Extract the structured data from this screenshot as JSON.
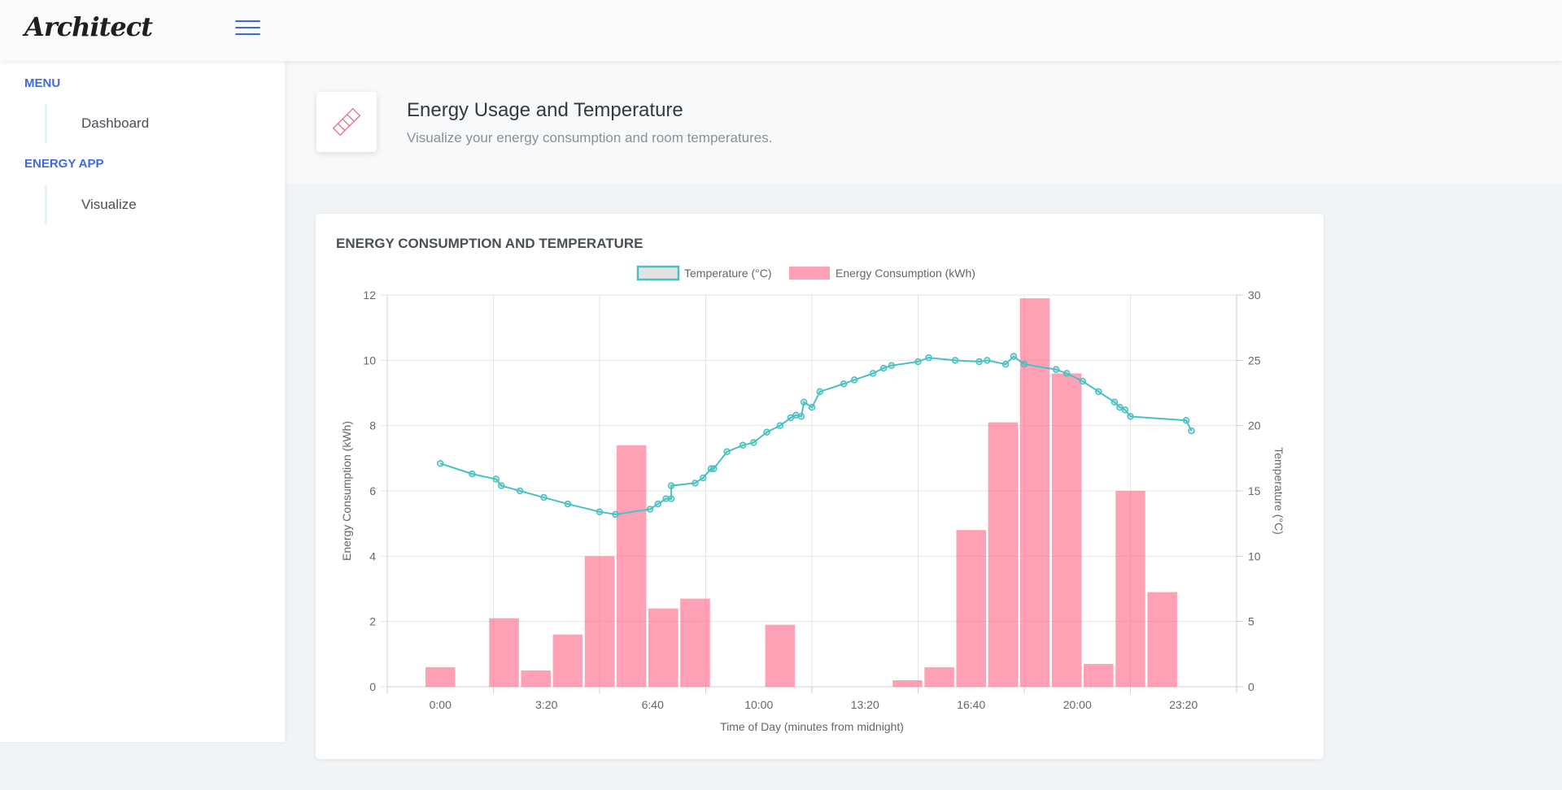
{
  "header": {
    "logo_text": "Architect",
    "menu_icon": "hamburger-icon"
  },
  "sidebar": {
    "sections": [
      {
        "heading": "MENU",
        "items": [
          {
            "label": "Dashboard"
          }
        ]
      },
      {
        "heading": "ENERGY APP",
        "items": [
          {
            "label": "Visualize"
          }
        ]
      }
    ]
  },
  "page": {
    "icon": "ruler-icon",
    "title": "Energy Usage and Temperature",
    "subtitle": "Visualize your energy consumption and room temperatures."
  },
  "card": {
    "title": "ENERGY CONSUMPTION AND TEMPERATURE"
  },
  "colors": {
    "temperature": "#4bc0c0",
    "energy": "#ff6384",
    "accent": "#3f6ad8"
  },
  "chart_data": {
    "type": "bar",
    "xlabel": "Time of Day (minutes from midnight)",
    "ylabel_left": "Energy Consumption (kWh)",
    "ylabel_right": "Temperature (°C)",
    "xlim": [
      -100,
      1500
    ],
    "xticks": [
      0,
      200,
      400,
      600,
      800,
      1000,
      1200,
      1400
    ],
    "xtick_labels": [
      "0:00",
      "3:20",
      "6:40",
      "10:00",
      "13:20",
      "16:40",
      "20:00",
      "23:20"
    ],
    "ylim_left": [
      0,
      12
    ],
    "yticks_left": [
      0,
      2,
      4,
      6,
      8,
      10,
      12
    ],
    "ylim_right": [
      0,
      30
    ],
    "yticks_right": [
      0,
      5,
      10,
      15,
      20,
      25,
      30
    ],
    "legend_position": "top",
    "grid": true,
    "series": [
      {
        "name": "Temperature (°C)",
        "type": "line",
        "axis": "right",
        "x": [
          0,
          60,
          105,
          115,
          150,
          195,
          240,
          300,
          330,
          395,
          410,
          425,
          435,
          435,
          480,
          495,
          510,
          515,
          540,
          570,
          590,
          615,
          640,
          660,
          670,
          680,
          685,
          700,
          715,
          760,
          780,
          815,
          835,
          850,
          900,
          920,
          970,
          1015,
          1030,
          1065,
          1080,
          1100,
          1160,
          1180,
          1210,
          1240,
          1270,
          1280,
          1290,
          1300,
          1405,
          1415
        ],
        "values": [
          17.1,
          16.3,
          15.9,
          15.4,
          15.0,
          14.5,
          14.0,
          13.4,
          13.2,
          13.6,
          14.0,
          14.4,
          14.4,
          15.4,
          15.6,
          16.0,
          16.7,
          16.7,
          18.0,
          18.5,
          18.7,
          19.5,
          20.0,
          20.6,
          20.8,
          20.7,
          21.8,
          21.4,
          22.6,
          23.2,
          23.5,
          24.0,
          24.4,
          24.6,
          24.9,
          25.2,
          25.0,
          24.9,
          25.0,
          24.7,
          25.3,
          24.7,
          24.3,
          24.0,
          23.4,
          22.6,
          21.8,
          21.4,
          21.2,
          20.7,
          20.4,
          19.6
        ]
      },
      {
        "name": "Energy Consumption (kWh)",
        "type": "bar",
        "axis": "left",
        "x": [
          0,
          120,
          180,
          240,
          300,
          360,
          420,
          480,
          640,
          880,
          940,
          1000,
          1060,
          1120,
          1180,
          1240,
          1300,
          1360
        ],
        "values": [
          0.6,
          2.1,
          0.5,
          1.6,
          4.0,
          7.4,
          2.4,
          2.7,
          1.9,
          0.2,
          0.6,
          4.8,
          8.1,
          11.9,
          9.6,
          0.7,
          6.0,
          2.9
        ]
      }
    ]
  }
}
